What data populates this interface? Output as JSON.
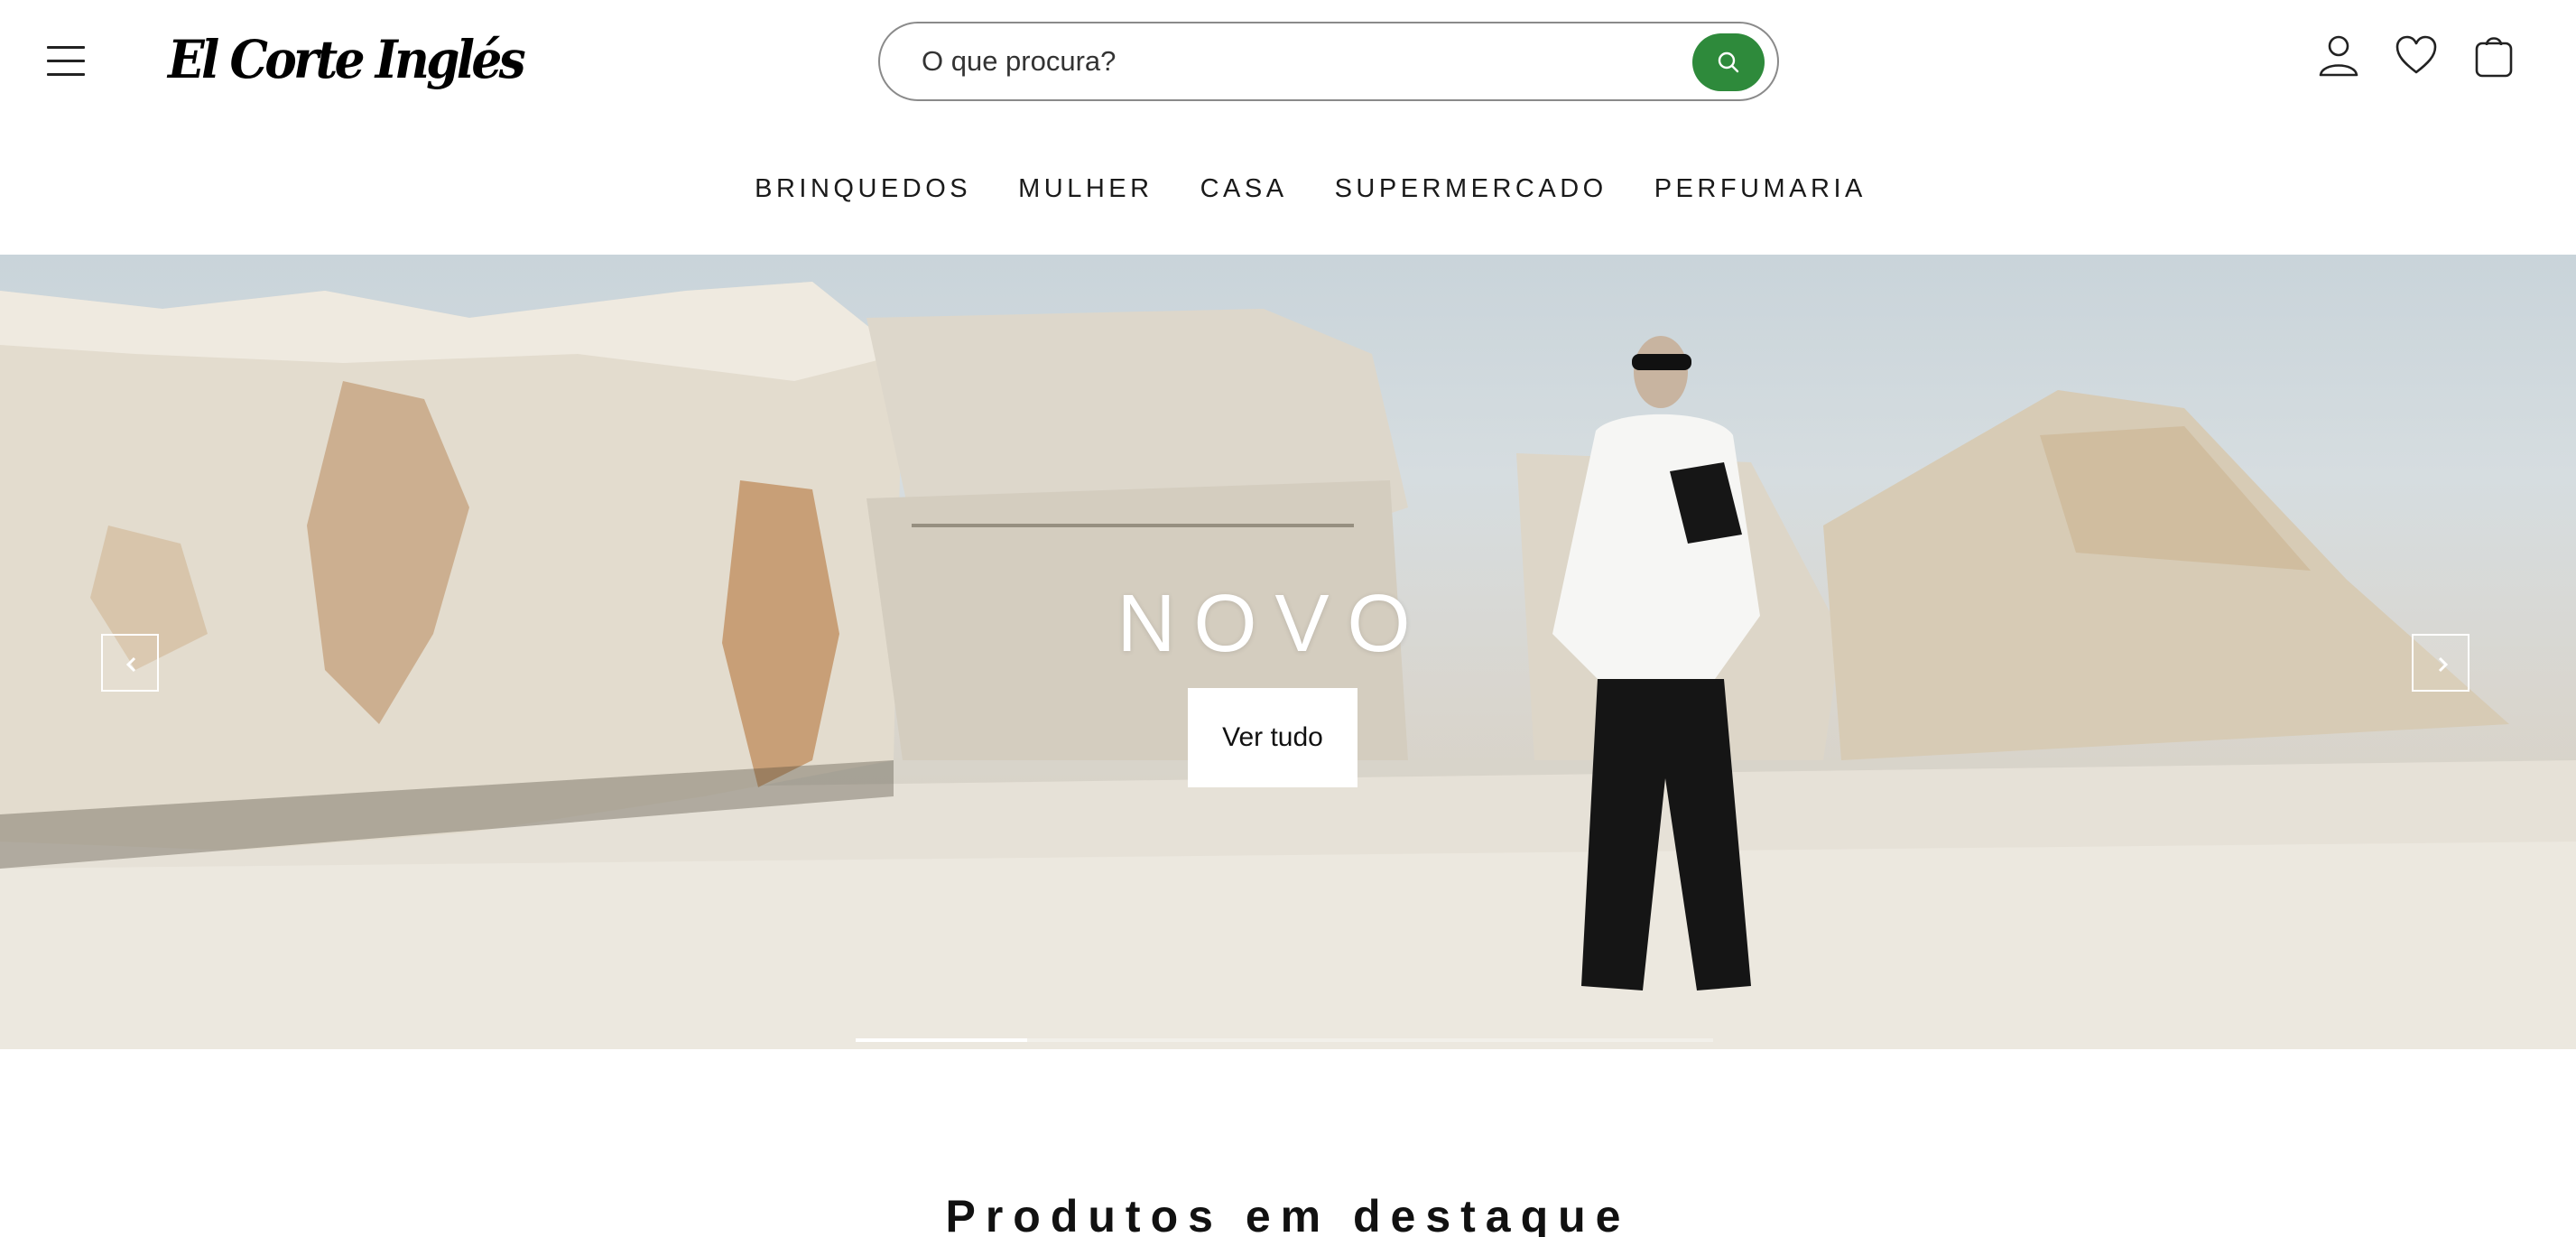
{
  "header": {
    "logo_text": "El Corte Inglés",
    "search": {
      "placeholder": "O que procura?"
    },
    "icons": [
      "menu-icon",
      "search-icon",
      "user-icon",
      "heart-icon",
      "bag-icon"
    ]
  },
  "nav": {
    "items": [
      {
        "label": "BRINQUEDOS"
      },
      {
        "label": "MULHER"
      },
      {
        "label": "CASA"
      },
      {
        "label": "SUPERMERCADO"
      },
      {
        "label": "PERFUMARIA"
      }
    ]
  },
  "hero": {
    "title": "NOVO",
    "button_label": "Ver tudo",
    "slide_progress": 0.2
  },
  "featured": {
    "title": "Produtos em destaque"
  },
  "colors": {
    "brand_green": "#2e8a3b",
    "text": "#111111",
    "background": "#ffffff"
  }
}
